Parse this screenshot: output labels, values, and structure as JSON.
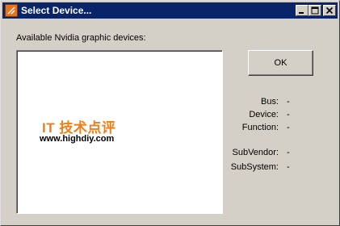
{
  "window": {
    "title": "Select Device...",
    "controls": {
      "minimize": "minimize",
      "maximize": "maximize",
      "close": "close"
    }
  },
  "devices_label": "Available  Nvidia graphic devices:",
  "device_list": {
    "items": [],
    "watermark": {
      "title": "IT 技术点评",
      "url": "www.highdiy.com"
    }
  },
  "ok_label": "OK",
  "info": [
    {
      "label": "Bus:",
      "value": "-"
    },
    {
      "label": "Device:",
      "value": "-"
    },
    {
      "label": "Function:",
      "value": "-"
    },
    {
      "label": "SubVendor:",
      "value": "-"
    },
    {
      "label": "SubSystem:",
      "value": "-"
    }
  ],
  "colors": {
    "titlebar": "#0a246a",
    "face": "#d4d0c8",
    "watermark": "#f07d16"
  }
}
